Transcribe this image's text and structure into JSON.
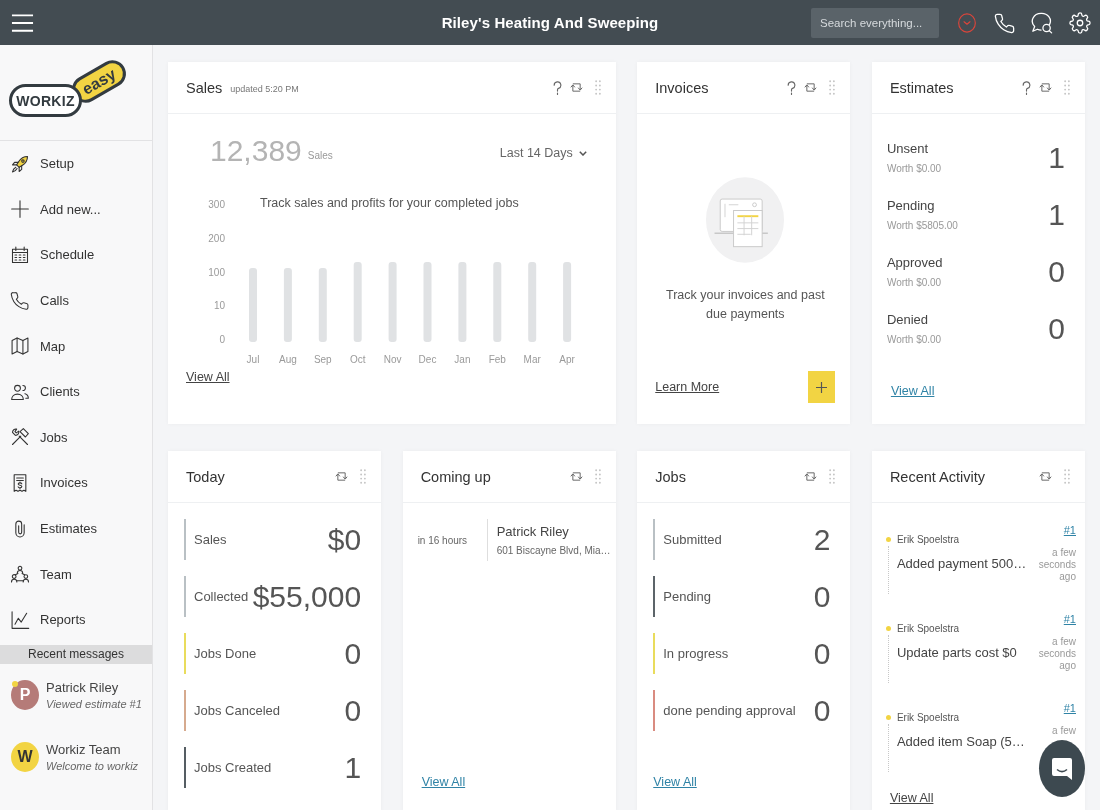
{
  "top_bar": {
    "title": "Riley's Heating And Sweeping",
    "search": {
      "placeholder": "Search everything..."
    }
  },
  "sidebar": {
    "logo": {
      "wordmark": "WORKIZ",
      "tagline": "easy"
    },
    "items": [
      {
        "label": "Setup"
      },
      {
        "label": "Add new..."
      },
      {
        "label": "Schedule"
      },
      {
        "label": "Calls"
      },
      {
        "label": "Map"
      },
      {
        "label": "Clients"
      },
      {
        "label": "Jobs"
      },
      {
        "label": "Invoices"
      },
      {
        "label": "Estimates"
      },
      {
        "label": "Team"
      },
      {
        "label": "Reports"
      }
    ],
    "recent_messages": {
      "title": "Recent messages",
      "items": [
        {
          "initial": "P",
          "name": "Patrick Riley",
          "preview": "Viewed estimate #1",
          "unread": true,
          "color": "#b57b78"
        },
        {
          "initial": "W",
          "name": "Workiz Team",
          "preview": "Welcome to workiz",
          "unread": false,
          "color": "#f2d443"
        }
      ]
    }
  },
  "sales": {
    "title": "Sales",
    "updated": "updated 5:20 PM",
    "help_button": true,
    "total": "12,389",
    "total_label": "Sales",
    "range": "Last 14 Days",
    "empty_message": "Track sales and profits for your completed jobs",
    "chart_placeholder": {
      "y_labels": [
        "300",
        "200",
        "100",
        "10",
        "0"
      ],
      "x_labels": [
        "Jul",
        "Aug",
        "Sep",
        "Oct",
        "Nov",
        "Dec",
        "Jan",
        "Feb",
        "Mar",
        "Apr"
      ]
    },
    "link": "View All"
  },
  "invoices": {
    "title": "Invoices",
    "help_button": true,
    "message": "Track your invoices and past due payments",
    "link": "Learn More"
  },
  "estimates": {
    "title": "Estimates",
    "help_button": true,
    "rows": [
      {
        "label": "Unsent",
        "worth": "Worth $0.00",
        "count": "1"
      },
      {
        "label": "Pending",
        "worth": "Worth $5805.00",
        "count": "1"
      },
      {
        "label": "Approved",
        "worth": "Worth $0.00",
        "count": "0"
      },
      {
        "label": "Denied",
        "worth": "Worth $0.00",
        "count": "0"
      }
    ],
    "link": "View All"
  },
  "today": {
    "title": "Today",
    "rows": [
      {
        "label": "Sales",
        "value": "$0",
        "color": "#b9c0c4"
      },
      {
        "label": "Collected",
        "value": "$55,000",
        "color": "#b9c0c4"
      },
      {
        "label": "Jobs Done",
        "value": "0",
        "color": "#e9dc5c"
      },
      {
        "label": "Jobs Canceled",
        "value": "0",
        "color": "#d6aa8e"
      },
      {
        "label": "Jobs Created",
        "value": "1",
        "color": "#555d63"
      }
    ]
  },
  "coming_up": {
    "title": "Coming up",
    "events": [
      {
        "when": "in 16 hours",
        "name": "Patrick Riley",
        "address": "601 Biscayne Blvd, Mia…"
      }
    ],
    "link": "View All"
  },
  "jobs": {
    "title": "Jobs",
    "rows": [
      {
        "label": "Submitted",
        "value": "2",
        "color": "#b9c0c4"
      },
      {
        "label": "Pending",
        "value": "0",
        "color": "#5c6469"
      },
      {
        "label": "In progress",
        "value": "0",
        "color": "#e9dc5c"
      },
      {
        "label": "done pending approval",
        "value": "0",
        "color": "#d98b80"
      }
    ],
    "link": "View All"
  },
  "recent_activity": {
    "title": "Recent Activity",
    "items": [
      {
        "user": "Erik Spoelstra",
        "action": "Added payment 500…",
        "ref": "#1",
        "time": "a few seconds ago"
      },
      {
        "user": "Erik Spoelstra",
        "action": "Update parts cost $0",
        "ref": "#1",
        "time": "a few seconds ago"
      },
      {
        "user": "Erik Spoelstra",
        "action": "Added item Soap (5…",
        "ref": "#1",
        "time": "a few"
      }
    ],
    "link": "View All"
  }
}
